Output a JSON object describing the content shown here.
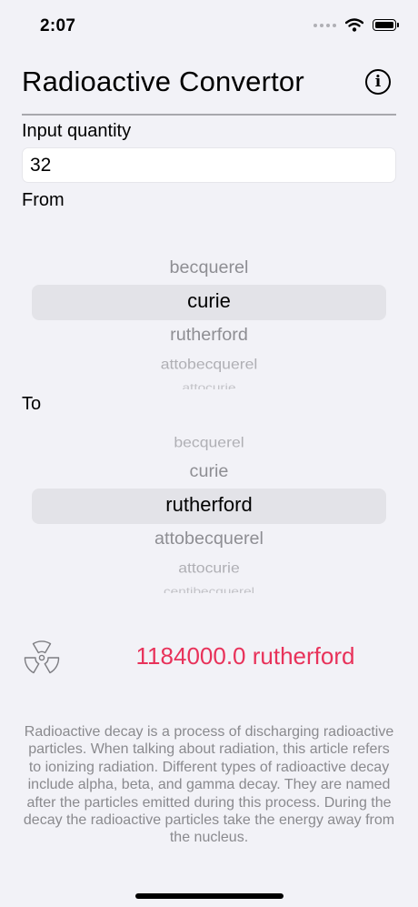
{
  "status_bar": {
    "time": "2:07"
  },
  "header": {
    "title": "Radioactive Convertor",
    "info_icon": "info-circle-icon",
    "info_glyph": "i"
  },
  "input": {
    "label": "Input quantity",
    "value": "32"
  },
  "from": {
    "label": "From",
    "selected": "curie",
    "options": [
      "becquerel",
      "curie",
      "rutherford",
      "attobecquerel",
      "attocurie"
    ]
  },
  "to": {
    "label": "To",
    "selected": "rutherford",
    "options": [
      "becquerel",
      "curie",
      "rutherford",
      "attobecquerel",
      "attocurie",
      "centibecquerel"
    ]
  },
  "result": {
    "text": "1184000.0 rutherford",
    "color": "#e8325a",
    "icon": "radiation-icon"
  },
  "description": "Radioactive decay is a process of discharging radioactive particles. When talking about radiation, this article refers to ionizing radiation. Different types of radioactive decay include alpha, beta, and gamma decay. They are named after the particles emitted during this process. During the decay the radioactive particles take the energy away from the nucleus."
}
